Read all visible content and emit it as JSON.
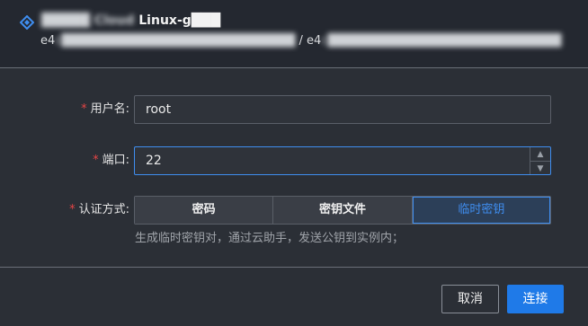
{
  "header": {
    "title_blurred": "█████ Cloud",
    "title": "Linux-g███",
    "subtitle_prefix": "e4",
    "subtitle_blurred_1": "c██████████████████████████",
    "subtitle_sep": " / e4",
    "subtitle_blurred_2": "c██████████████████████████"
  },
  "form": {
    "username": {
      "label": "用户名:",
      "value": "root"
    },
    "port": {
      "label": "端口:",
      "value": "22"
    },
    "auth": {
      "label": "认证方式:",
      "options": [
        "密码",
        "密钥文件",
        "临时密钥"
      ],
      "selected": "临时密钥",
      "hint": "生成临时密钥对，通过云助手，发送公钥到实例内；"
    },
    "required_mark": "*"
  },
  "footer": {
    "cancel_label": "取消",
    "connect_label": "连接"
  },
  "colors": {
    "accent": "#3f8ef0",
    "primary_button": "#1f7ae8",
    "required": "#e54545"
  }
}
